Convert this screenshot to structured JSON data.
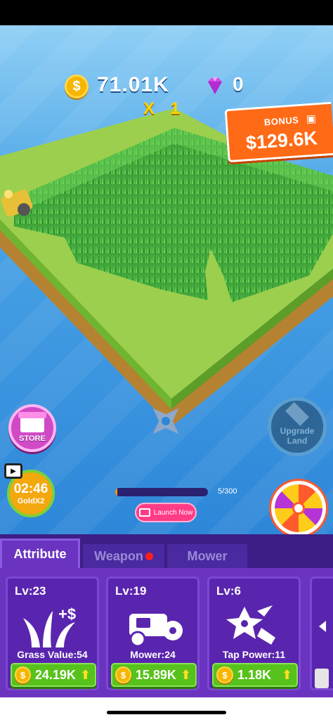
{
  "hud": {
    "coin_symbol": "$",
    "money": "71.01K",
    "multiplier": "X 1",
    "gems": "0"
  },
  "bonus": {
    "label": "BONUS",
    "amount": "$129.6K"
  },
  "buttons": {
    "store": "STORE",
    "upgrade_land_line1": "Upgrade",
    "upgrade_land_line2": "Land",
    "timer": "02:46",
    "gold_boost": "GoldX2",
    "launch_now": "Launch Now"
  },
  "progress": {
    "text": "5/300",
    "value": 5,
    "max": 300
  },
  "tabs": {
    "attribute": "Attribute",
    "weapon": "Weapon",
    "mower": "Mower"
  },
  "cards": [
    {
      "level": "Lv:23",
      "name": "Grass Value:54",
      "price": "24.19K",
      "art": "grass-value-icon"
    },
    {
      "level": "Lv:19",
      "name": "Mower:24",
      "price": "15.89K",
      "art": "mower-icon"
    },
    {
      "level": "Lv:6",
      "name": "Tap Power:11",
      "price": "1.18K",
      "art": "tap-power-icon"
    }
  ],
  "colors": {
    "panel": "#5b2ca8",
    "coin": "#f7b500",
    "buy_button": "#57c21b",
    "bonus": "#ff6a16",
    "grass": "#3ea53a"
  }
}
